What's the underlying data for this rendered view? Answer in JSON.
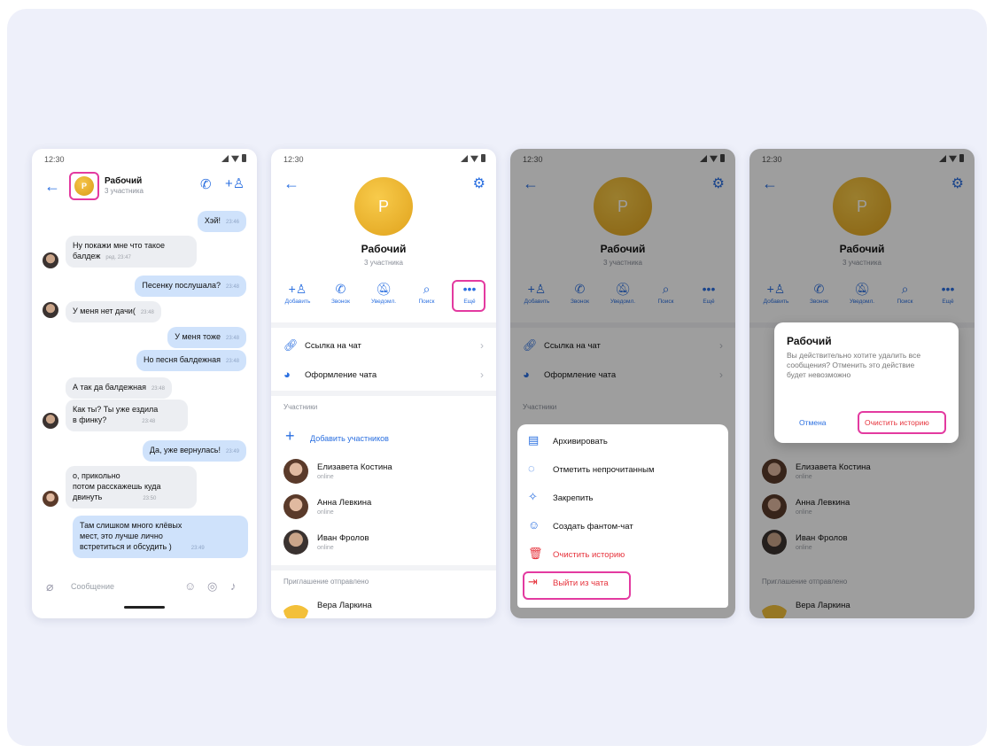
{
  "status_time": "12:30",
  "phone1": {
    "chat_title": "Рабочий",
    "chat_sub": "3 участника",
    "avatar_letter": "Р",
    "messages": [
      {
        "text": "Хэй!",
        "time": "23:46"
      },
      {
        "text": "Ну покажи мне что такое",
        "text2": "балдеж",
        "time": "ред. 23:47"
      },
      {
        "text": "Песенку послушала?",
        "time": "23:48"
      },
      {
        "text": "У меня нет дачи(",
        "time": "23:48"
      },
      {
        "text": "У меня тоже",
        "time": "23:48"
      },
      {
        "text": "Но песня балдежная",
        "time": "23:48"
      },
      {
        "text": "А так да балдежная",
        "time": "23:48"
      },
      {
        "text": "Как ты? Ты уже ездила",
        "text2": "в финку?",
        "time": "23:48"
      },
      {
        "text": "Да, уже вернулась!",
        "time": "23:49"
      },
      {
        "text": "о, прикольно",
        "text2": "потом расскажешь куда",
        "text3": "двинуть",
        "time": "23:50"
      },
      {
        "text": "Там слишком много клёвых",
        "text2": "мест, это лучше лично",
        "text3": "встретиться и обсудить )",
        "time": "23:49"
      }
    ],
    "composer_placeholder": "Сообщение"
  },
  "profile": {
    "avatar_letter": "Р",
    "name": "Рабочий",
    "sub": "3 участника",
    "actions": [
      {
        "label": "Добавить",
        "icon": "add-user-icon"
      },
      {
        "label": "Звонок",
        "icon": "phone-icon"
      },
      {
        "label": "Уведомл.",
        "icon": "bell-off-icon"
      },
      {
        "label": "Поиск",
        "icon": "search-icon"
      },
      {
        "label": "Ещё",
        "icon": "more-icon"
      }
    ],
    "link_row": "Ссылка на чат",
    "design_row": "Оформление чата",
    "members_section": "Участники",
    "add_members": "Добавить участников",
    "members": [
      {
        "name": "Елизавета Костина",
        "status": "online"
      },
      {
        "name": "Анна Левкина",
        "status": "online"
      },
      {
        "name": "Иван Фролов",
        "status": "online"
      }
    ],
    "invite_section": "Приглашение отправлено",
    "invite_name": "Вера Ларкина"
  },
  "sheet": {
    "items": [
      {
        "label": "Архивировать",
        "icon": "archive-icon"
      },
      {
        "label": "Отметить непрочитанным",
        "icon": "chat-bubble-icon"
      },
      {
        "label": "Закрепить",
        "icon": "pin-icon"
      },
      {
        "label": "Создать фантом-чат",
        "icon": "ghost-icon"
      },
      {
        "label": "Очистить историю",
        "icon": "trash-icon"
      },
      {
        "label": "Выйти из чата",
        "icon": "logout-icon"
      }
    ]
  },
  "dialog": {
    "title": "Рабочий",
    "text": "Вы действительно хотите удалить все сообщения? Отменить это действие будет невозможно",
    "cancel": "Отмена",
    "clear": "Очистить историю"
  },
  "colors": {
    "accent": "#2a6fe0",
    "highlight": "#e33aa0",
    "danger": "#e6333c"
  }
}
